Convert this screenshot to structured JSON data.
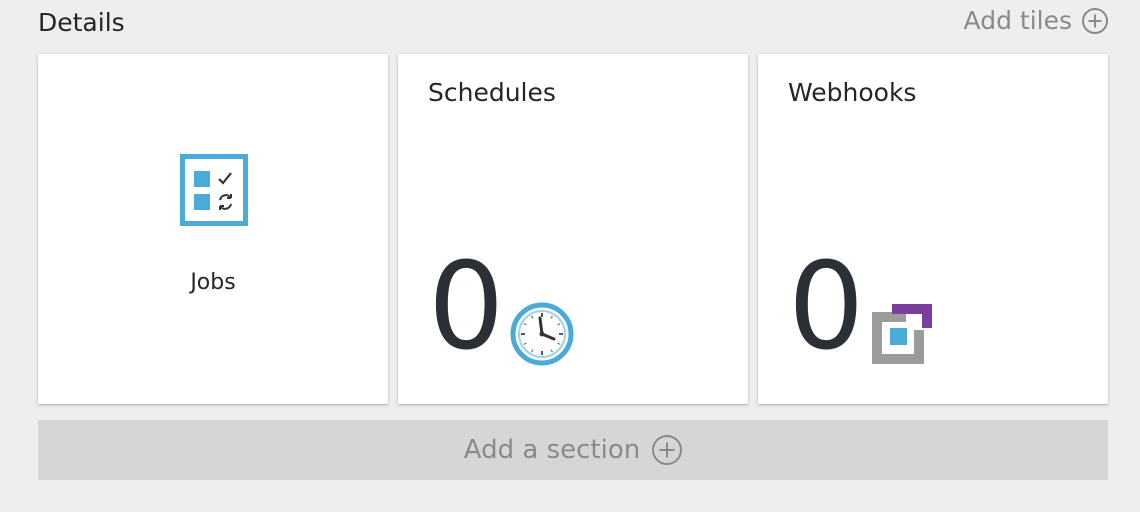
{
  "header": {
    "title": "Details",
    "add_tiles_label": "Add tiles",
    "add_tiles_icon": "add-circle-icon"
  },
  "tiles": {
    "jobs": {
      "label": "Jobs",
      "icon": "jobs-icon"
    },
    "schedules": {
      "title": "Schedules",
      "count": "0",
      "icon": "clock-icon"
    },
    "webhooks": {
      "title": "Webhooks",
      "count": "0",
      "icon": "webhook-icon"
    }
  },
  "footer": {
    "add_section_label": "Add a section",
    "add_section_icon": "add-circle-icon"
  },
  "colors": {
    "background": "#eeeeee",
    "tile": "#ffffff",
    "accent_blue": "#4aaad8",
    "webhook_purple": "#7a3e9d",
    "webhook_gray": "#9b9b9b",
    "muted_text": "#8a8a8a",
    "add_section_bg": "#d6d6d6"
  }
}
